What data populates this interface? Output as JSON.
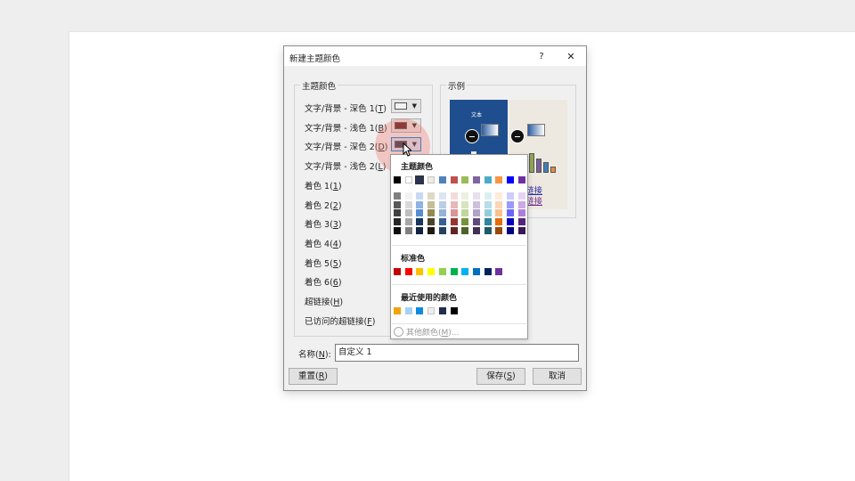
{
  "dialog": {
    "title": "新建主题颜色",
    "help": "?",
    "close": "✕"
  },
  "theme_colors": {
    "group_title": "主题颜色",
    "rows": [
      {
        "label": "文字/背景 - 深色 1",
        "key": "T",
        "color": "#f2f2f2"
      },
      {
        "label": "文字/背景 - 浅色 1",
        "key": "B",
        "color": "#5a1a1a"
      },
      {
        "label": "文字/背景 - 深色 2",
        "key": "D",
        "color": "#2a3352"
      },
      {
        "label": "文字/背景 - 浅色 2",
        "key": "L",
        "color": null
      },
      {
        "label": "着色 1",
        "key": "1",
        "color": null
      },
      {
        "label": "着色 2",
        "key": "2",
        "color": null
      },
      {
        "label": "着色 3",
        "key": "3",
        "color": null
      },
      {
        "label": "着色 4",
        "key": "4",
        "color": null
      },
      {
        "label": "着色 5",
        "key": "5",
        "color": null
      },
      {
        "label": "着色 6",
        "key": "6",
        "color": null
      },
      {
        "label": "超链接",
        "key": "H",
        "color": null
      },
      {
        "label": "已访问的超链接",
        "key": "F",
        "color": null
      }
    ]
  },
  "sample": {
    "group_title": "示例",
    "text": "文本",
    "link1": "链接",
    "link2": "链接"
  },
  "palette": {
    "theme_heading": "主题颜色",
    "theme_top": [
      "#000000",
      "#ffffff",
      "#2a3352",
      "#eeece1",
      "#4f81bd",
      "#c0504d",
      "#9bbb59",
      "#8064a2",
      "#4bacc6",
      "#f79646",
      "#0000ff",
      "#7030a0"
    ],
    "theme_shades": [
      [
        "#7f7f7f",
        "#f2f2f2",
        "#c6d9f1",
        "#ddd9c4",
        "#dce6f2",
        "#f2dcdb",
        "#ebf1de",
        "#e6e0ec",
        "#dbeef4",
        "#fdeada",
        "#ccccff",
        "#e6d4f3"
      ],
      [
        "#595959",
        "#d9d9d9",
        "#8eb4e3",
        "#c4bd97",
        "#b9cde5",
        "#e6b9b8",
        "#d7e4bd",
        "#ccc1da",
        "#b7dee8",
        "#fcd5b5",
        "#9999ff",
        "#cba8e6"
      ],
      [
        "#404040",
        "#bfbfbf",
        "#558ed5",
        "#948a54",
        "#95b3d7",
        "#d99694",
        "#c3d69b",
        "#b3a2c7",
        "#93cddd",
        "#fac090",
        "#6666ff",
        "#b07dd9"
      ],
      [
        "#262626",
        "#a6a6a6",
        "#17375e",
        "#4a452a",
        "#376092",
        "#953735",
        "#77933c",
        "#604a7b",
        "#31859c",
        "#e46c0a",
        "#0000bf",
        "#54247a"
      ],
      [
        "#0d0d0d",
        "#808080",
        "#10243f",
        "#1e1c11",
        "#254061",
        "#632523",
        "#4f6228",
        "#403152",
        "#215968",
        "#984807",
        "#00007f",
        "#381852"
      ]
    ],
    "standard_heading": "标准色",
    "standard": [
      "#c00000",
      "#ff0000",
      "#ffc000",
      "#ffff00",
      "#92d050",
      "#00b050",
      "#00b0f0",
      "#0070c0",
      "#002060",
      "#7030a0"
    ],
    "recent_heading": "最近使用的颜色",
    "recent": [
      "#f0a30a",
      "#a6d2f2",
      "#0f8ae0",
      "#eeeeee",
      "#1f2f4e",
      "#000000"
    ],
    "more_label": "其他颜色(",
    "more_key": "M",
    "more_suffix": ")..."
  },
  "name_field": {
    "label": "名称(",
    "key": "N",
    "label_suffix": "):",
    "value": "自定义 1"
  },
  "buttons": {
    "reset": "重置(",
    "reset_key": "R",
    "save": "保存(",
    "save_key": "S",
    "cancel": "取消"
  }
}
